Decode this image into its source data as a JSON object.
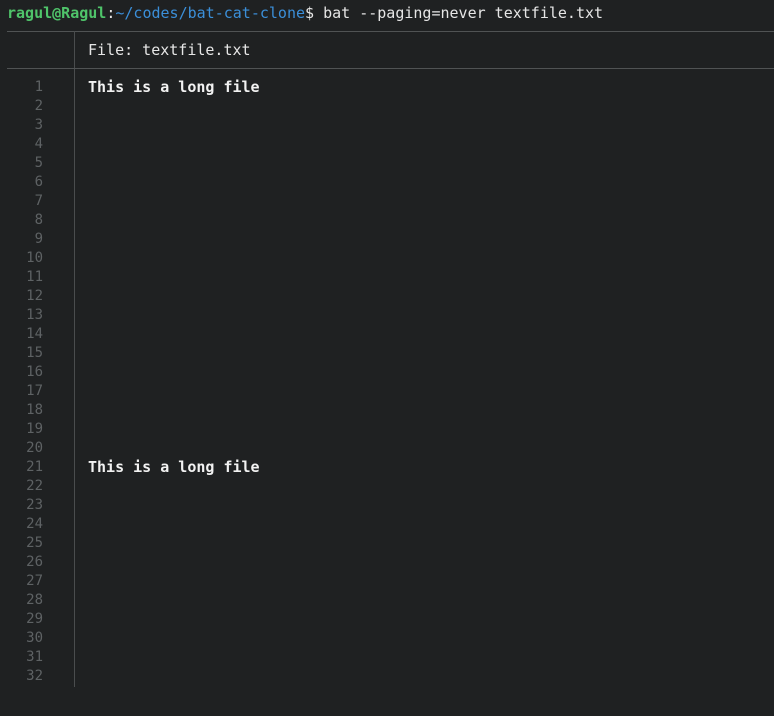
{
  "terminal": {
    "prompt_user_host": "ragul@Ragul",
    "prompt_colon": ":",
    "prompt_path": "~/codes/bat-cat-clone",
    "prompt_dollar": "$",
    "command": " bat --paging=never textfile.txt"
  },
  "file": {
    "header": "File: textfile.txt",
    "lines": [
      {
        "number": "1",
        "content": "This is a long file"
      },
      {
        "number": "2",
        "content": ""
      },
      {
        "number": "3",
        "content": ""
      },
      {
        "number": "4",
        "content": ""
      },
      {
        "number": "5",
        "content": ""
      },
      {
        "number": "6",
        "content": ""
      },
      {
        "number": "7",
        "content": ""
      },
      {
        "number": "8",
        "content": ""
      },
      {
        "number": "9",
        "content": ""
      },
      {
        "number": "10",
        "content": ""
      },
      {
        "number": "11",
        "content": ""
      },
      {
        "number": "12",
        "content": ""
      },
      {
        "number": "13",
        "content": ""
      },
      {
        "number": "14",
        "content": ""
      },
      {
        "number": "15",
        "content": ""
      },
      {
        "number": "16",
        "content": ""
      },
      {
        "number": "17",
        "content": ""
      },
      {
        "number": "18",
        "content": ""
      },
      {
        "number": "19",
        "content": ""
      },
      {
        "number": "20",
        "content": ""
      },
      {
        "number": "21",
        "content": "This is a long file"
      },
      {
        "number": "22",
        "content": ""
      },
      {
        "number": "23",
        "content": ""
      },
      {
        "number": "24",
        "content": ""
      },
      {
        "number": "25",
        "content": ""
      },
      {
        "number": "26",
        "content": ""
      },
      {
        "number": "27",
        "content": ""
      },
      {
        "number": "28",
        "content": ""
      },
      {
        "number": "29",
        "content": ""
      },
      {
        "number": "30",
        "content": ""
      },
      {
        "number": "31",
        "content": ""
      },
      {
        "number": "32",
        "content": ""
      }
    ]
  },
  "colors": {
    "background": "#1f2122",
    "prompt_user": "#4fc46a",
    "prompt_path": "#3b8fd9",
    "line_number": "#5e6264",
    "text": "#f2f2f2",
    "rule": "#505354"
  }
}
